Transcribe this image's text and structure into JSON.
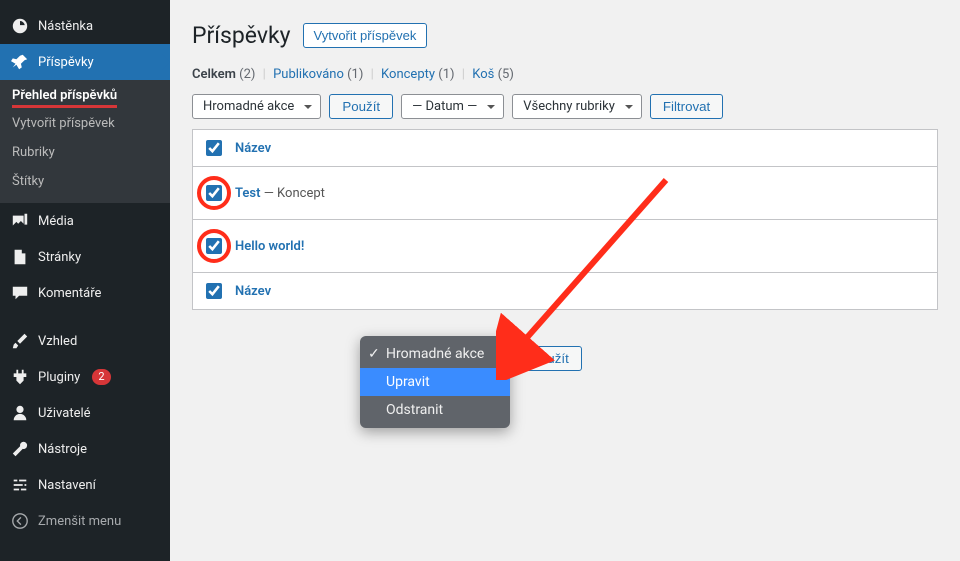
{
  "sidebar": {
    "items": [
      {
        "id": "dash",
        "label": "Nástěnka"
      },
      {
        "id": "posts",
        "label": "Příspěvky"
      },
      {
        "id": "media",
        "label": "Média"
      },
      {
        "id": "pages",
        "label": "Stránky"
      },
      {
        "id": "comments",
        "label": "Komentáře"
      },
      {
        "id": "appearance",
        "label": "Vzhled"
      },
      {
        "id": "plugins",
        "label": "Pluginy",
        "badge": "2"
      },
      {
        "id": "users",
        "label": "Uživatelé"
      },
      {
        "id": "tools",
        "label": "Nástroje"
      },
      {
        "id": "settings",
        "label": "Nastavení"
      },
      {
        "id": "collapse",
        "label": "Zmenšit menu"
      }
    ],
    "submenu_posts": [
      {
        "label": "Přehled příspěvků",
        "active": true
      },
      {
        "label": "Vytvořit příspěvek"
      },
      {
        "label": "Rubriky"
      },
      {
        "label": "Štítky"
      }
    ]
  },
  "header": {
    "title": "Příspěvky",
    "add_new": "Vytvořit příspěvek"
  },
  "filter_tabs": {
    "all_label": "Celkem",
    "all_count": "(2)",
    "published_label": "Publikováno",
    "published_count": "(1)",
    "drafts_label": "Koncepty",
    "drafts_count": "(1)",
    "trash_label": "Koš",
    "trash_count": "(5)"
  },
  "toolbar": {
    "bulk_action": "Hromadné akce",
    "apply": "Použít",
    "date": "— Datum —",
    "category": "Všechny rubriky",
    "filter": "Filtrovat"
  },
  "table": {
    "col_name": "Název",
    "rows": [
      {
        "title": "Test",
        "status_suffix": " — Koncept",
        "checked": true
      },
      {
        "title": "Hello world!",
        "status_suffix": "",
        "checked": true
      }
    ]
  },
  "action_popup": {
    "bulk": "Hromadné akce",
    "edit": "Upravit",
    "delete": "Odstranit"
  },
  "apply_bottom": "Použít"
}
